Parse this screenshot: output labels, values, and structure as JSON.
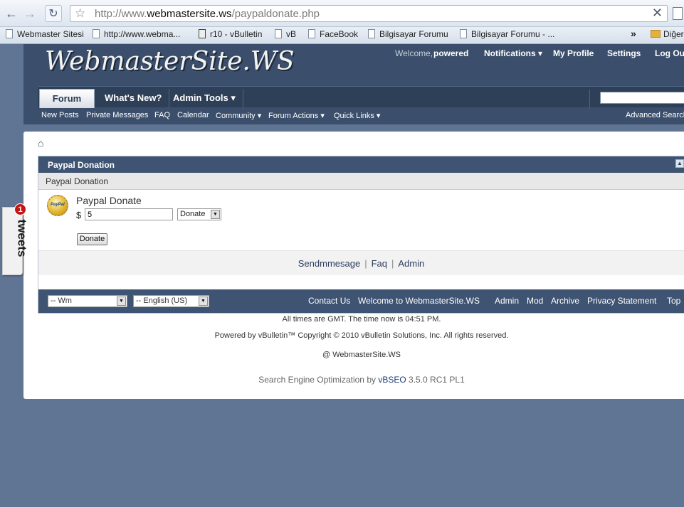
{
  "browser": {
    "url_prefix": "http://www.",
    "url_domain": "webmastersite.ws",
    "url_path": "/paypaldonate.php",
    "bookmarks": [
      "Webmaster Sitesi",
      "http://www.webma...",
      "r10 - vBulletin",
      "vB",
      "FaceBook",
      "Bilgisayar Forumu",
      "Bilgisayar Forumu - ..."
    ],
    "bookmarks_more": "»",
    "bookmarks_folder": "Diğer"
  },
  "header": {
    "logo": "WebmasterSite.WS",
    "welcome_label": "Welcome,",
    "username": "powered",
    "notifications": "Notifications",
    "my_profile": "My Profile",
    "settings": "Settings",
    "logout": "Log Out"
  },
  "navbar": {
    "tabs": [
      "Forum",
      "What's New?",
      "Admin Tools"
    ],
    "subnav": [
      "New Posts",
      "Private Messages",
      "FAQ",
      "Calendar",
      "Community",
      "Forum Actions",
      "Quick Links"
    ],
    "advanced_search": "Advanced Search"
  },
  "block": {
    "title": "Paypal Donation",
    "subtitle": "Paypal Donation",
    "badge_text": "PayPal",
    "donate_title": "Paypal Donate",
    "currency_symbol": "$",
    "amount_value": "5",
    "type_selected": "Donate",
    "submit_label": "Donate"
  },
  "links": {
    "sendmessage": "Sendmmesage",
    "faq": "Faq",
    "admin": "Admin",
    "separator": "|"
  },
  "footer": {
    "style_selected": "-- Wm",
    "language_selected": "-- English (US)",
    "links": [
      "Contact Us",
      "Welcome to WebmasterSite.WS",
      "Admin",
      "Mod",
      "Archive",
      "Privacy Statement",
      "Top"
    ],
    "time_note": "All times are GMT. The time now is 04:51 PM.",
    "powered_by": "Powered by vBulletin™ Copyright © 2010 vBulletin Solutions, Inc. All rights reserved.",
    "site_credit": "@ WebmasterSite.WS",
    "seo_prefix": "Search Engine Optimization by ",
    "seo_brand": "vBSEO",
    "seo_version": " 3.5.0 RC1 PL1"
  },
  "tweets": {
    "label": "tweets",
    "badge_count": "1"
  }
}
